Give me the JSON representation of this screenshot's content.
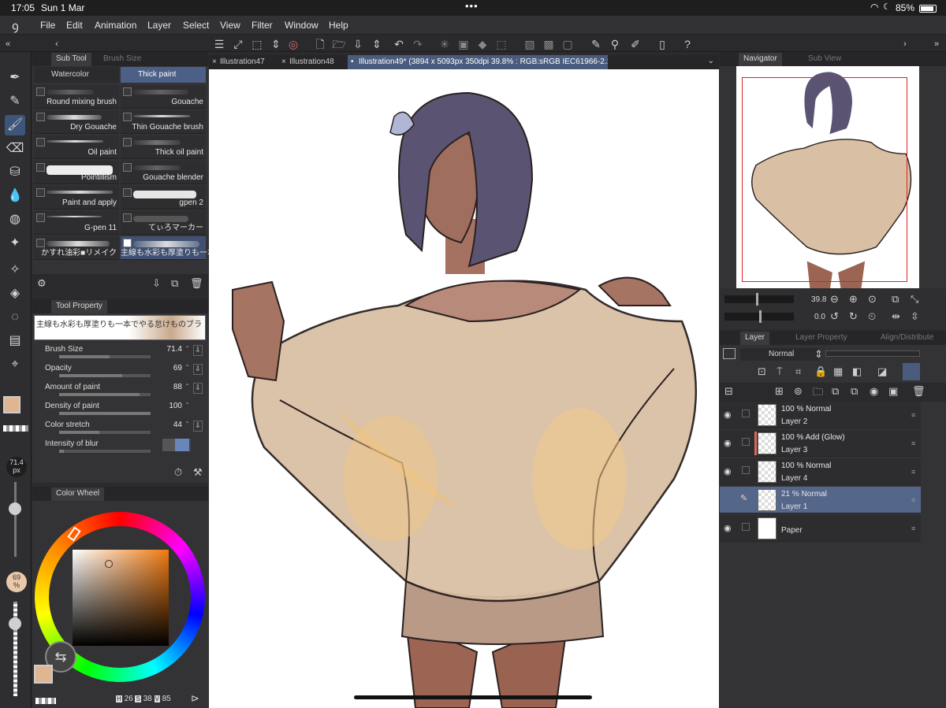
{
  "status": {
    "time": "17:05",
    "date": "Sun 1 Mar",
    "battery": "85%",
    "dots": "•••"
  },
  "menu": [
    "File",
    "Edit",
    "Animation",
    "Layer",
    "Select",
    "View",
    "Filter",
    "Window",
    "Help"
  ],
  "doc_tabs": [
    "Illustration47",
    "Illustration48",
    "Illustration49* (3894 x 5093px 350dpi 39.8% : RGB:sRGB IEC61966-2.1)"
  ],
  "subtool": {
    "tab1": "Sub Tool",
    "tab2": "Brush Size",
    "group1": "Watercolor",
    "group2": "Thick paint",
    "brushes": [
      "Round mixing brush",
      "Gouache",
      "Dry Gouache",
      "Thin Gouache brush",
      "Oil paint",
      "Thick oil paint",
      "Pointillism",
      "Gouache blender",
      "Paint and apply",
      "gpen 2",
      "G-pen 11",
      "てぃろマーカー",
      "かすれ油彩■リメイク",
      "主線も水彩も厚塗りも一本"
    ]
  },
  "toolprop": {
    "title": "Tool Property",
    "brush_name": "主線も水彩も厚塗りも一本でやる怠けものブラシ",
    "props": [
      {
        "label": "Brush Size",
        "value": "71.4",
        "fill": 0.55
      },
      {
        "label": "Opacity",
        "value": "69",
        "fill": 0.69
      },
      {
        "label": "Amount of paint",
        "value": "88",
        "fill": 0.88
      },
      {
        "label": "Density of paint",
        "value": "100",
        "fill": 1.0
      },
      {
        "label": "Color stretch",
        "value": "44",
        "fill": 0.44
      },
      {
        "label": "Intensity of blur",
        "value": "0.1",
        "fill": 0.05
      }
    ]
  },
  "left_strip": {
    "size_value": "71.4",
    "size_unit": "px",
    "opacity_value": "69",
    "opacity_unit": "%"
  },
  "color": {
    "title": "Color Wheel",
    "h_label": "H",
    "h": "26",
    "s_label": "S",
    "s": "38",
    "v_label": "V",
    "v": "85",
    "main": "#e0b690",
    "sub": "#1c1c1c",
    "highlight": "#d96a5a"
  },
  "navigator": {
    "title": "Navigator",
    "subview": "Sub View",
    "zoom": "39.8",
    "angle": "0.0"
  },
  "layers": {
    "tab1": "Layer",
    "tab2": "Layer Property",
    "tab3": "Align/Distribute",
    "blend": "Normal",
    "items": [
      {
        "opacity": "100 %",
        "mode": "Normal",
        "name": "Layer 2",
        "visible": true,
        "selected": false,
        "mark": false
      },
      {
        "opacity": "100 %",
        "mode": "Add (Glow)",
        "name": "Layer 3",
        "visible": true,
        "selected": false,
        "mark": true
      },
      {
        "opacity": "100 %",
        "mode": "Normal",
        "name": "Layer 4",
        "visible": true,
        "selected": false,
        "mark": false
      },
      {
        "opacity": "21 %",
        "mode": "Normal",
        "name": "Layer 1",
        "visible": false,
        "selected": true,
        "mark": false
      },
      {
        "opacity": "",
        "mode": "",
        "name": "Paper",
        "visible": true,
        "selected": false,
        "mark": false
      }
    ]
  }
}
